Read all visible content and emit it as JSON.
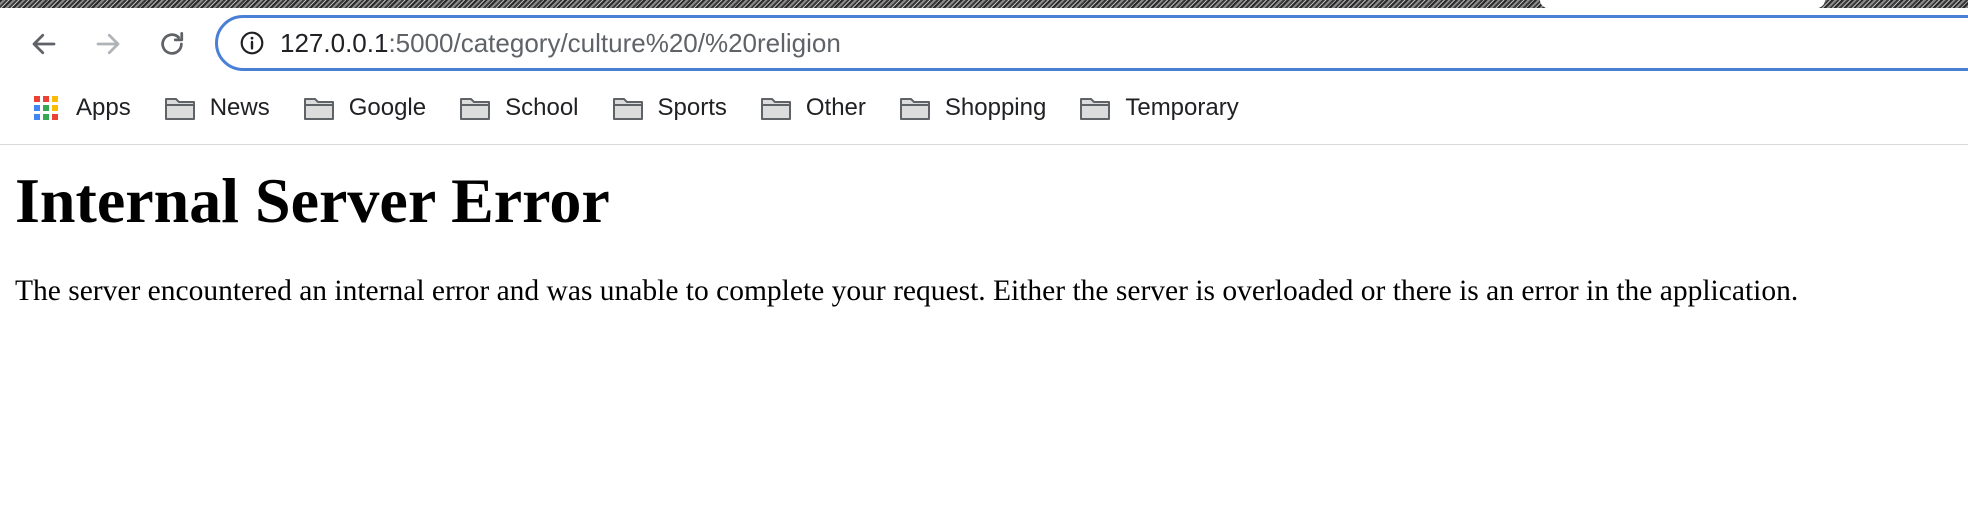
{
  "browser": {
    "url_host": "127.0.0.1",
    "url_path": ":5000/category/culture%20/%20religion",
    "accent_color": "#4a7fd6"
  },
  "toolbar": {
    "back_icon": "arrow-left-icon",
    "forward_icon": "arrow-right-icon",
    "reload_icon": "reload-icon",
    "info_icon": "info-circle-icon"
  },
  "bookmarks": [
    {
      "label": "Apps",
      "icon": "apps-grid-icon"
    },
    {
      "label": "News",
      "icon": "folder-icon"
    },
    {
      "label": "Google",
      "icon": "folder-icon"
    },
    {
      "label": "School",
      "icon": "folder-icon"
    },
    {
      "label": "Sports",
      "icon": "folder-icon"
    },
    {
      "label": "Other",
      "icon": "folder-icon"
    },
    {
      "label": "Shopping",
      "icon": "folder-icon"
    },
    {
      "label": "Temporary",
      "icon": "folder-icon"
    }
  ],
  "page": {
    "heading": "Internal Server Error",
    "message": "The server encountered an internal error and was unable to complete your request. Either the server is overloaded or there is an error in the application."
  }
}
